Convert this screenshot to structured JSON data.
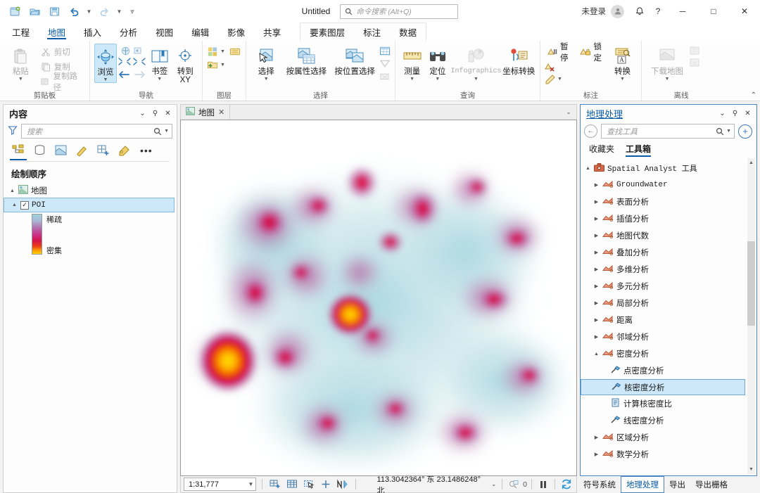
{
  "app": {
    "title": "Untitled",
    "command_search_placeholder": "命令搜索 (Alt+Q)",
    "sign_in": "未登录",
    "icons": {
      "new_project": "new-project-icon",
      "open_project": "open-project-icon",
      "save_project": "save-project-icon",
      "undo": "undo-icon",
      "redo": "redo-icon",
      "customize_qat": "customize-quick-access-toolbar-icon",
      "account": "account-avatar-icon",
      "notifications": "bell-icon",
      "help": "help-icon",
      "minimize": "minimize-icon",
      "maximize": "maximize-icon",
      "close": "close-icon"
    },
    "window_buttons": {
      "minimize": "─",
      "maximize": "□",
      "close": "✕",
      "help": "?"
    }
  },
  "ribbon": {
    "tabs": [
      {
        "label": "工程",
        "active": false
      },
      {
        "label": "地图",
        "active": true
      },
      {
        "label": "插入",
        "active": false
      },
      {
        "label": "分析",
        "active": false
      },
      {
        "label": "视图",
        "active": false
      },
      {
        "label": "编辑",
        "active": false
      },
      {
        "label": "影像",
        "active": false
      },
      {
        "label": "共享",
        "active": false
      }
    ],
    "contextual_tabs": [
      {
        "label": "要素图层",
        "active": true
      },
      {
        "label": "标注",
        "active": false
      },
      {
        "label": "数据",
        "active": false
      }
    ],
    "groups": [
      {
        "title": "剪贴板",
        "big": [
          {
            "label": "粘贴",
            "label2": "",
            "dropdown": true,
            "disabled": true
          }
        ],
        "small": [
          {
            "label": "剪切",
            "disabled": true
          },
          {
            "label": "复制",
            "disabled": true
          },
          {
            "label": "复制路径",
            "disabled": true
          }
        ]
      },
      {
        "title": "导航",
        "big": [
          {
            "label": "浏览",
            "label2": "",
            "dropdown": true,
            "selected": true
          },
          {
            "label": "书签",
            "label2": "",
            "dropdown": true
          },
          {
            "label": "转到",
            "label2": "XY",
            "dropdown": false
          }
        ]
      },
      {
        "title": "图层",
        "big": []
      },
      {
        "title": "选择",
        "big": [
          {
            "label": "选择",
            "label2": "",
            "dropdown": true
          },
          {
            "label": "按属性选择",
            "label2": "",
            "dropdown": false
          },
          {
            "label": "按位置选择",
            "label2": "",
            "dropdown": false
          }
        ]
      },
      {
        "title": "查询",
        "big": [
          {
            "label": "测量",
            "label2": "",
            "dropdown": true
          },
          {
            "label": "定位",
            "label2": "",
            "dropdown": true
          },
          {
            "label": "Infographics",
            "label2": "",
            "dropdown": true,
            "disabled": true
          },
          {
            "label": "坐标转换",
            "label2": "",
            "dropdown": false
          }
        ]
      },
      {
        "title": "标注",
        "small": [
          {
            "label": "暂停"
          },
          {
            "label": "锁定"
          }
        ],
        "big": [
          {
            "label": "转换",
            "label2": "",
            "dropdown": true
          }
        ]
      },
      {
        "title": "离线",
        "big": [
          {
            "label": "下载地图",
            "label2": "",
            "dropdown": true,
            "disabled": true
          }
        ]
      }
    ]
  },
  "contents": {
    "title": "内容",
    "search_placeholder": "搜索",
    "toolbar_icons": [
      "list-by-drawing-order-icon",
      "list-by-data-source-icon",
      "list-by-selection-icon",
      "list-by-editing-icon",
      "list-by-snapping-icon",
      "list-by-labeling-icon"
    ],
    "more_label": "•••",
    "drawing_order_label": "绘制顺序",
    "map_node": "地图",
    "layer": {
      "name": "POI",
      "checked": true,
      "selected": true
    },
    "legend": {
      "high_label": "稀疏",
      "low_label": "密集"
    }
  },
  "map": {
    "tab_label": "地图",
    "close_glyph": "✕",
    "scale": "1:31,777",
    "coordinates": "113.3042364° 东  23.1486248° 北",
    "selected_count": "0",
    "status_icons": [
      "add-basemap-icon",
      "attribute-table-icon",
      "select-tool-icon",
      "clear-selection-icon",
      "north-arrow-icon"
    ],
    "pause_drawing_icon": "pause-icon",
    "refresh_icon": "refresh-icon"
  },
  "geoprocessing": {
    "title": "地理处理",
    "search_placeholder": "查找工具",
    "add_tool_glyph": "+",
    "back_glyph": "←",
    "tabs": [
      {
        "label": "收藏夹",
        "active": false
      },
      {
        "label": "工具箱",
        "active": true
      }
    ],
    "tree": [
      {
        "label": "Spatial Analyst 工具",
        "level": 0,
        "expanded": true,
        "icon": "toolbox-icon",
        "mono": true
      },
      {
        "label": "Groundwater",
        "level": 1,
        "expanded": false,
        "icon": "toolset-icon",
        "mono": true
      },
      {
        "label": "表面分析",
        "level": 1,
        "expanded": false,
        "icon": "toolset-icon"
      },
      {
        "label": "插值分析",
        "level": 1,
        "expanded": false,
        "icon": "toolset-icon"
      },
      {
        "label": "地图代数",
        "level": 1,
        "expanded": false,
        "icon": "toolset-icon"
      },
      {
        "label": "叠加分析",
        "level": 1,
        "expanded": false,
        "icon": "toolset-icon"
      },
      {
        "label": "多维分析",
        "level": 1,
        "expanded": false,
        "icon": "toolset-icon"
      },
      {
        "label": "多元分析",
        "level": 1,
        "expanded": false,
        "icon": "toolset-icon"
      },
      {
        "label": "局部分析",
        "level": 1,
        "expanded": false,
        "icon": "toolset-icon"
      },
      {
        "label": "距离",
        "level": 1,
        "expanded": false,
        "icon": "toolset-icon"
      },
      {
        "label": "邻域分析",
        "level": 1,
        "expanded": false,
        "icon": "toolset-icon"
      },
      {
        "label": "密度分析",
        "level": 1,
        "expanded": true,
        "icon": "toolset-icon"
      },
      {
        "label": "点密度分析",
        "level": 2,
        "icon": "tool-icon"
      },
      {
        "label": "核密度分析",
        "level": 2,
        "icon": "tool-icon",
        "selected": true
      },
      {
        "label": "计算核密度比",
        "level": 2,
        "icon": "script-tool-icon"
      },
      {
        "label": "线密度分析",
        "level": 2,
        "icon": "tool-icon"
      },
      {
        "label": "区域分析",
        "level": 1,
        "expanded": false,
        "icon": "toolset-icon"
      },
      {
        "label": "数学分析",
        "level": 1,
        "expanded": false,
        "icon": "toolset-icon"
      }
    ],
    "bottom_tabs": [
      {
        "label": "符号系统",
        "active": false
      },
      {
        "label": "地理处理",
        "active": true
      },
      {
        "label": "导出",
        "active": false
      },
      {
        "label": "导出栅格",
        "active": false
      }
    ]
  },
  "colors": {
    "accent": "#0b5ca8",
    "selection": "#cde8f9",
    "panel_border": "#4a86c5",
    "heat_low": "#b8dde3",
    "heat_mid": "#c0539a",
    "heat_high": "#e00000",
    "heat_peak": "#ffe000"
  }
}
